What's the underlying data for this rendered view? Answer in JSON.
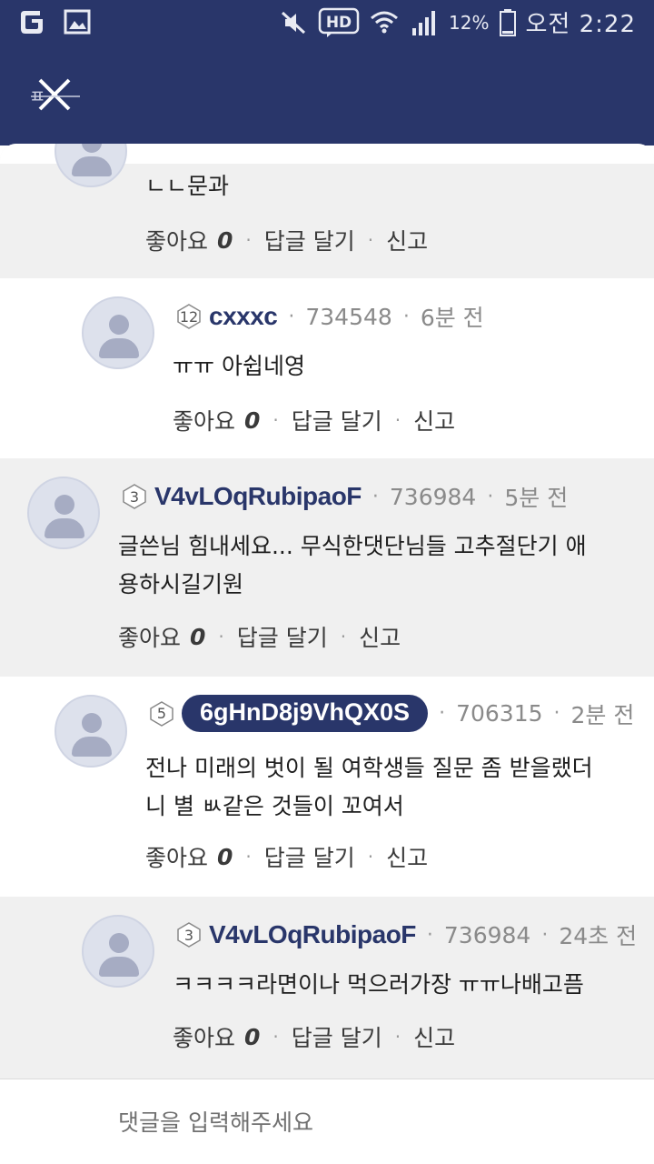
{
  "status_bar": {
    "battery_pct": "12%",
    "time": "오전 2:22"
  },
  "header": {
    "close_icon_label": "ㅍ"
  },
  "comments": [
    {
      "content": "ㄴㄴ문과",
      "actions": {
        "like_label": "좋아요",
        "like_count": "0",
        "reply_label": "답글 달기",
        "report_label": "신고"
      }
    },
    {
      "level": "12",
      "username": "cxxxc",
      "points": "734548",
      "time_ago": "6분 전",
      "content": "ㅠㅠ 아쉽네영",
      "actions": {
        "like_label": "좋아요",
        "like_count": "0",
        "reply_label": "답글 달기",
        "report_label": "신고"
      }
    },
    {
      "level": "3",
      "username": "V4vLOqRubipaoF",
      "points": "736984",
      "time_ago": "5분 전",
      "content_line1": "글쓴님 힘내세요... 무식한댓단님들 고추절단기 애",
      "content_line2": "용하시길기원",
      "actions": {
        "like_label": "좋아요",
        "like_count": "0",
        "reply_label": "답글 달기",
        "report_label": "신고"
      }
    },
    {
      "level": "5",
      "username": "6gHnD8j9VhQX0S",
      "points": "706315",
      "time_ago": "2분 전",
      "content_line1": "전나 미래의 벗이 될 여학생들 질문 좀 받을랬더",
      "content_line2": "니 별 ㅄ같은 것들이 꼬여서",
      "actions": {
        "like_label": "좋아요",
        "like_count": "0",
        "reply_label": "답글 달기",
        "report_label": "신고"
      }
    },
    {
      "level": "3",
      "username": "V4vLOqRubipaoF",
      "points": "736984",
      "time_ago": "24초 전",
      "content": "ㅋㅋㅋㅋ라면이나 먹으러가장 ㅠㅠ나배고픔",
      "actions": {
        "like_label": "좋아요",
        "like_count": "0",
        "reply_label": "답글 달기",
        "report_label": "신고"
      }
    }
  ],
  "input": {
    "placeholder": "댓글을 입력해주세요"
  },
  "colors": {
    "brand": "#29366a",
    "gray_bg": "#f0f0f0",
    "white_bg": "#ffffff"
  }
}
